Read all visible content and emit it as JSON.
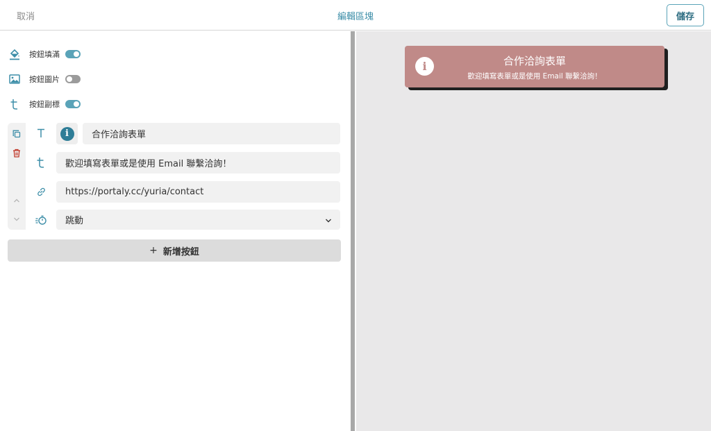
{
  "header": {
    "cancel_label": "取消",
    "title": "編輯區塊",
    "save_label": "儲存"
  },
  "settings": {
    "fill": {
      "label": "按鈕填滿",
      "enabled": true,
      "icon": "paint-bucket-icon"
    },
    "image": {
      "label": "按鈕圖片",
      "enabled": false,
      "icon": "image-icon"
    },
    "subtitle": {
      "label": "按鈕副標",
      "enabled": true,
      "icon": "subtitle-t-icon"
    }
  },
  "button_item": {
    "title": "合作洽詢表單",
    "subtitle": "歡迎填寫表單或是使用 Email 聯繫洽詢！",
    "url": "https://portaly.cc/yuria/contact",
    "action": "跳動"
  },
  "add_button_label": "新增按鈕",
  "preview": {
    "title": "合作洽詢表單",
    "subtitle": "歡迎填寫表單或是使用 Email 聯繫洽詢！"
  },
  "colors": {
    "accent": "#3d8ea8",
    "preview_bg": "#c08a88",
    "delete_red": "#c0392b"
  }
}
